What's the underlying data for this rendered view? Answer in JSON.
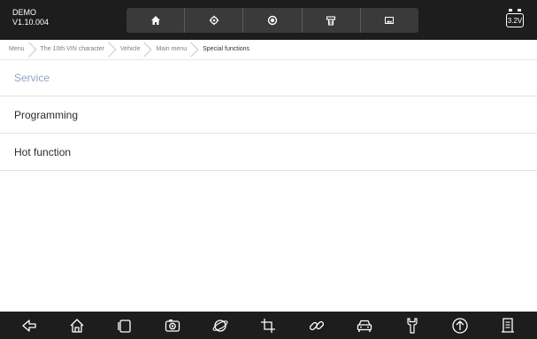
{
  "app": {
    "name": "DEMO",
    "version": "V1.10.004"
  },
  "toolbar": {
    "icons": [
      "home-icon",
      "gear-icon",
      "record-icon",
      "printer-icon",
      "image-icon"
    ]
  },
  "battery": {
    "voltage": "3.2V"
  },
  "breadcrumb": [
    "Menu",
    "The 10th VIN character",
    "Vehicle",
    "Main menu",
    "Special functions"
  ],
  "list": [
    {
      "label": "Service",
      "selected": true
    },
    {
      "label": "Programming",
      "selected": false
    },
    {
      "label": "Hot function",
      "selected": false
    }
  ],
  "bottom_nav": {
    "icons": [
      "back-icon",
      "home-icon",
      "recent-apps-icon",
      "camera-icon",
      "browser-icon",
      "crop-icon",
      "link-icon",
      "car-icon",
      "wrench-icon",
      "upload-icon",
      "report-icon"
    ]
  },
  "colors": {
    "bar_bg": "#1d1d1d",
    "toolbar_bg": "#3a3a3a",
    "selected_text": "#8fa6c4"
  }
}
